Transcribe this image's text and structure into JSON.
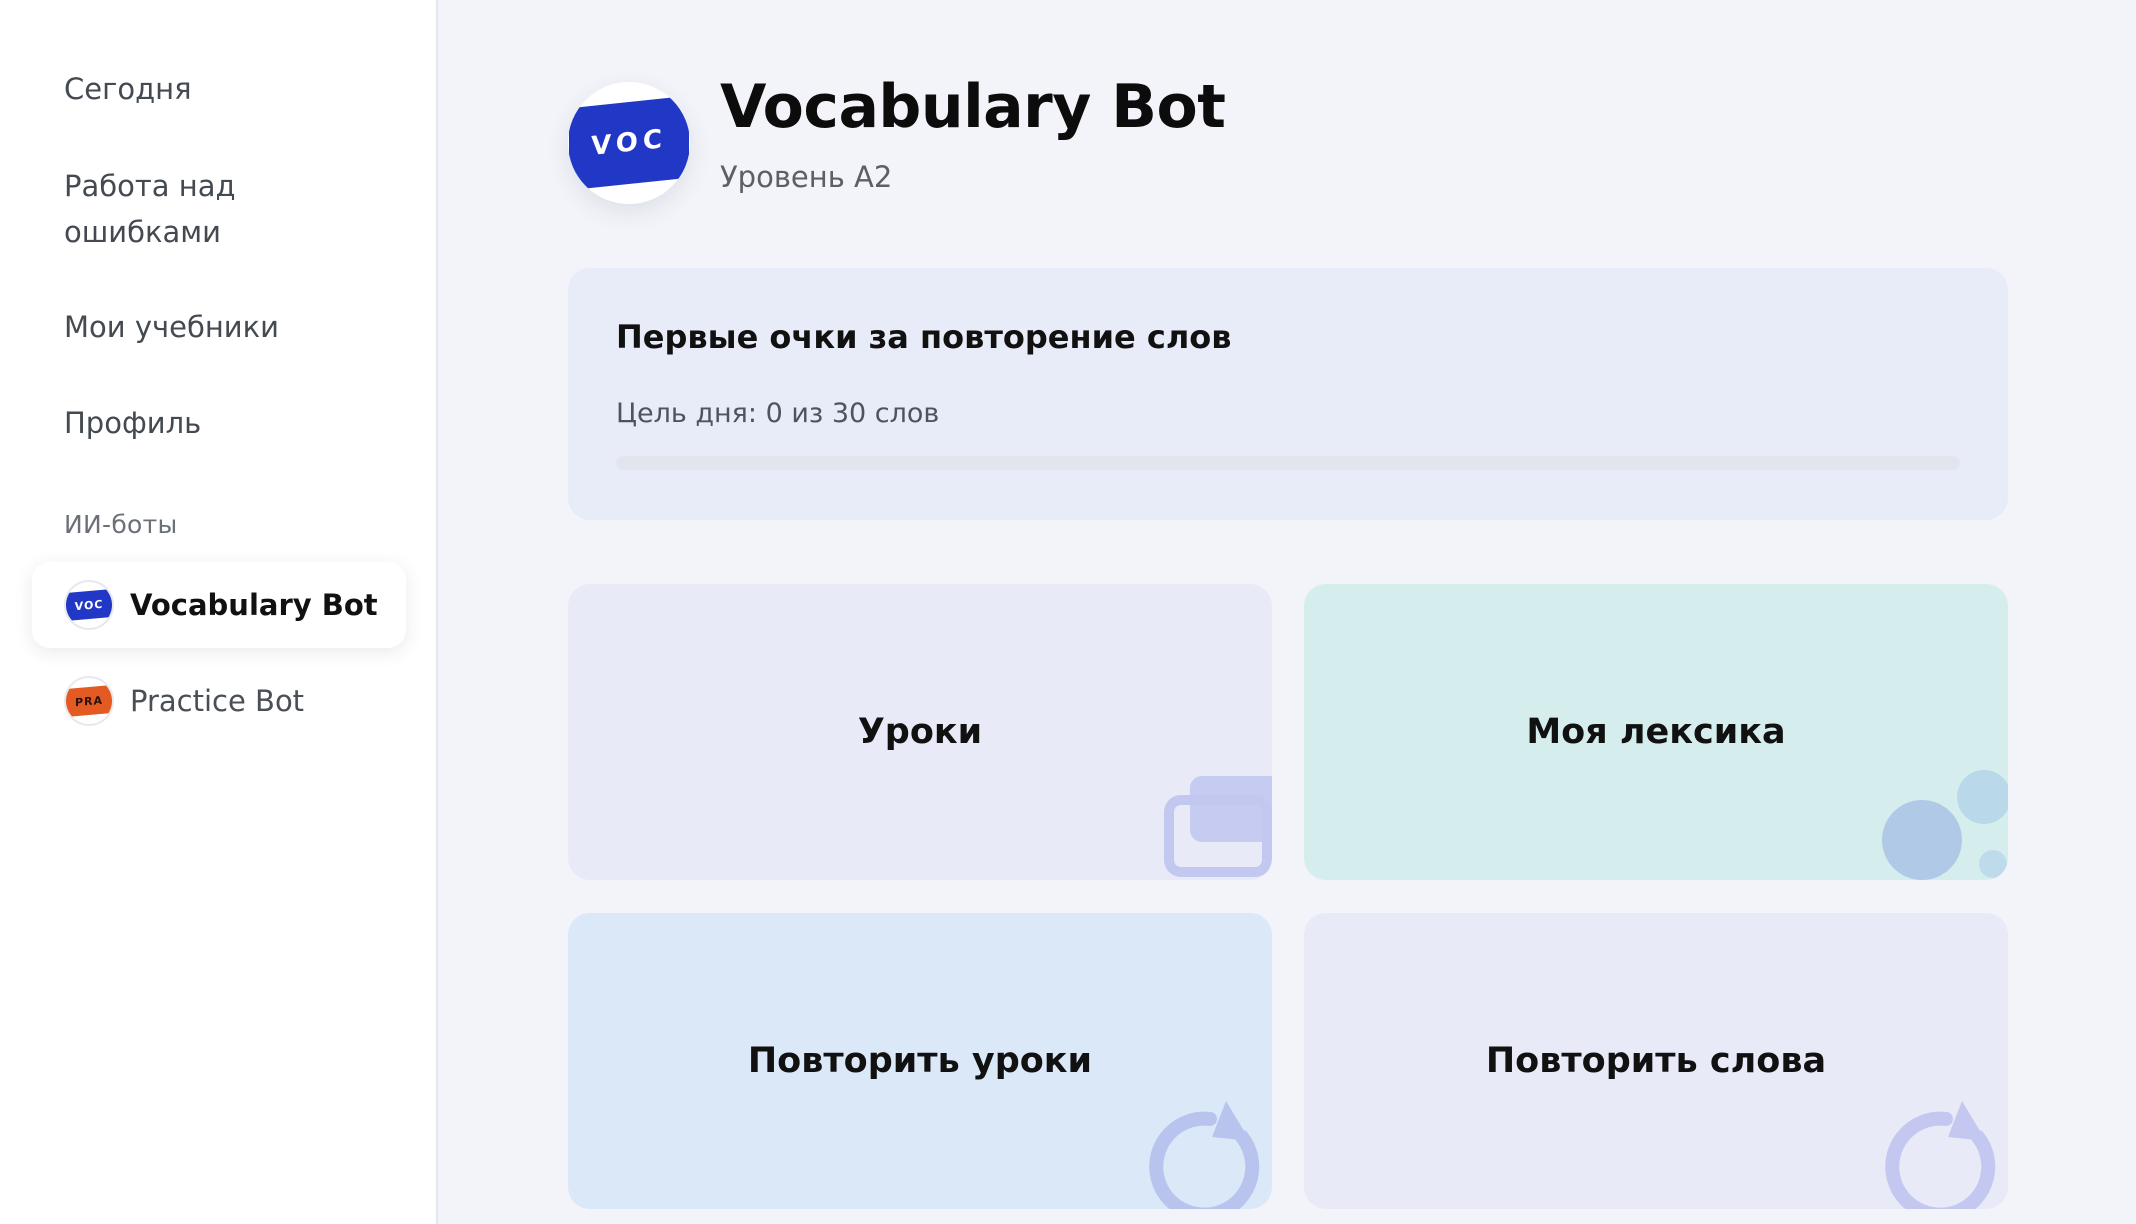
{
  "sidebar": {
    "nav": [
      {
        "label": "Сегодня"
      },
      {
        "label": "Работа над ошибками"
      },
      {
        "label": "Мои учебники"
      },
      {
        "label": "Профиль"
      }
    ],
    "section_label": "ИИ-боты",
    "bots": [
      {
        "name": "Vocabulary Bot",
        "icon_text": "VOC",
        "active": true
      },
      {
        "name": "Practice Bot",
        "icon_text": "PRA",
        "active": false
      }
    ]
  },
  "header": {
    "logo_text": "VOC",
    "title": "Vocabulary Bot",
    "subtitle": "Уровень A2"
  },
  "goal": {
    "title": "Первые очки за повторение слов",
    "text": "Цель дня: 0 из 30 слов",
    "progress_fraction": 0
  },
  "tiles": [
    {
      "label": "Уроки",
      "icon": "cards-icon"
    },
    {
      "label": "Моя лексика",
      "icon": "bubbles-icon"
    },
    {
      "label": "Повторить уроки",
      "icon": "refresh-icon"
    },
    {
      "label": "Повторить слова",
      "icon": "refresh-icon"
    }
  ],
  "colors": {
    "brand_blue": "#2138c6",
    "practice_orange": "#e35a22",
    "tile_lavender": "#e8eaf8",
    "tile_mint": "#d6edee",
    "tile_sky": "#dbe8f8"
  }
}
